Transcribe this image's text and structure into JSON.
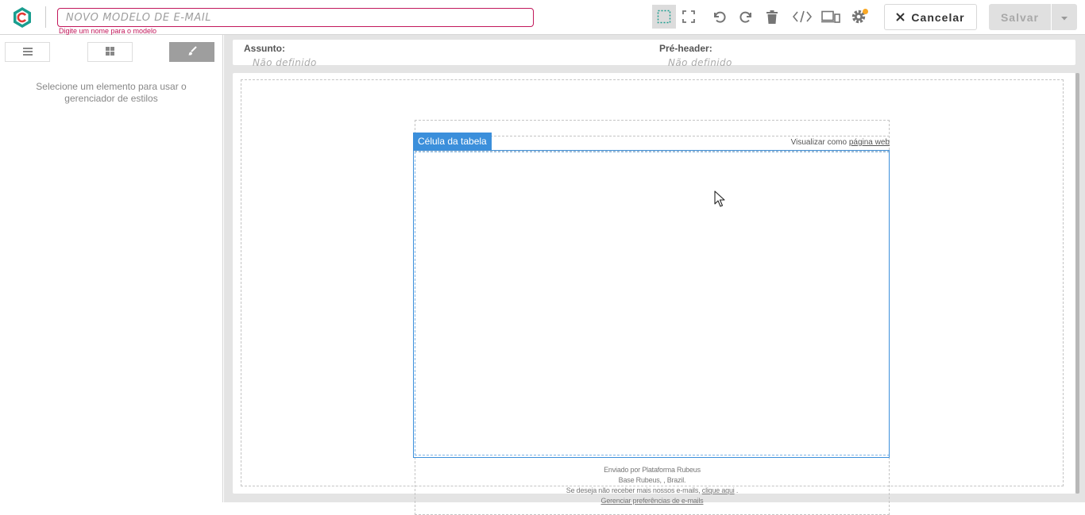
{
  "header": {
    "template_name_placeholder": "NOVO MODELO DE E-MAIL",
    "template_name_hint": "Digite um nome para o modelo",
    "toolbar": {
      "icons": [
        "select-icon",
        "fullscreen-icon",
        "undo-icon",
        "redo-icon",
        "trash-icon",
        "code-icon",
        "devices-icon",
        "settings-icon"
      ],
      "active": "select-icon"
    },
    "cancel_label": "Cancelar",
    "save_label": "Salvar"
  },
  "left_panel": {
    "tabs": [
      "layers-icon",
      "blocks-icon",
      "style-brush-icon"
    ],
    "active_tab": "style-brush-icon",
    "message": "Selecione um elemento para usar o gerenciador de estilos"
  },
  "email_meta": {
    "subject_label": "Assunto:",
    "subject_value": "Não definido",
    "preheader_label": "Pré-header:",
    "preheader_value": "Não definido"
  },
  "canvas": {
    "view_web_prefix": "Visualizar como ",
    "view_web_link": "página web",
    "selected_tag": "Célula da tabela",
    "footer": {
      "line1": "Enviado por Plataforma Rubeus",
      "line2": "Base Rubeus, , Brazil.",
      "line3_prefix": "Se deseja não receber mais nossos e-mails, ",
      "line3_link": "clique aqui",
      "line3_suffix": " .",
      "line4_link": "Gerenciar preferências de e-mails"
    }
  },
  "colors": {
    "brand_teal": "#1a9e8f",
    "brand_red": "#e53935",
    "hint_red": "#c2185b",
    "selection_blue": "#3b8fdb",
    "notify_yellow": "#f9a825"
  }
}
